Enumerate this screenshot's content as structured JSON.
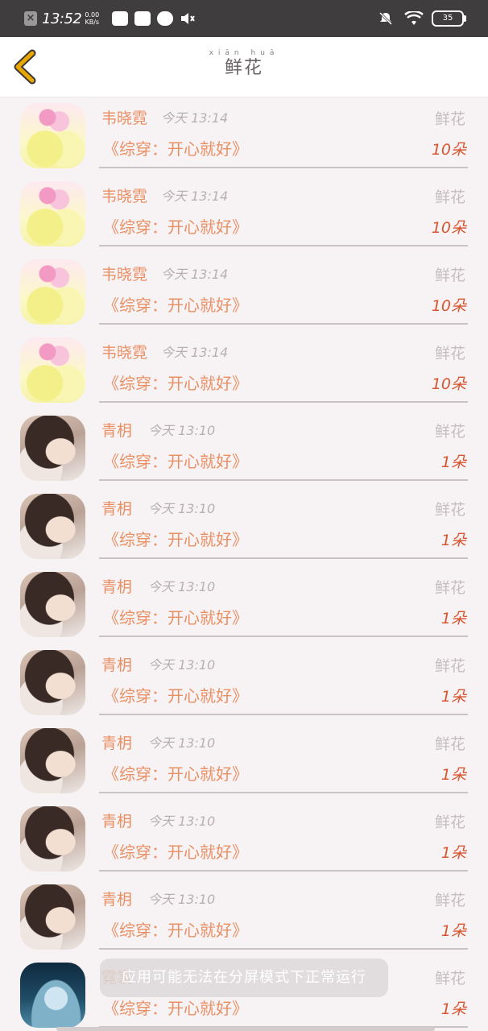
{
  "status_bar": {
    "time": "13:52",
    "speed_value": "0.00",
    "speed_unit": "KB/s",
    "battery": "35"
  },
  "header": {
    "title_pinyin": "xiān huā",
    "title": "鲜花",
    "back_icon": "chevron-left-icon",
    "accent_color": "#e8a600"
  },
  "gift_rows": [
    {
      "avatar": "flower",
      "name": "韦晓霓",
      "time": "今天 13:14",
      "gift_label": "鲜花",
      "book": "《综穿：开心就好》",
      "count": "10朵"
    },
    {
      "avatar": "flower",
      "name": "韦晓霓",
      "time": "今天 13:14",
      "gift_label": "鲜花",
      "book": "《综穿：开心就好》",
      "count": "10朵"
    },
    {
      "avatar": "flower",
      "name": "韦晓霓",
      "time": "今天 13:14",
      "gift_label": "鲜花",
      "book": "《综穿：开心就好》",
      "count": "10朵"
    },
    {
      "avatar": "flower",
      "name": "韦晓霓",
      "time": "今天 13:14",
      "gift_label": "鲜花",
      "book": "《综穿：开心就好》",
      "count": "10朵"
    },
    {
      "avatar": "girl",
      "name": "青枂",
      "time": "今天 13:10",
      "gift_label": "鲜花",
      "book": "《综穿：开心就好》",
      "count": "1朵"
    },
    {
      "avatar": "girl",
      "name": "青枂",
      "time": "今天 13:10",
      "gift_label": "鲜花",
      "book": "《综穿：开心就好》",
      "count": "1朵"
    },
    {
      "avatar": "girl",
      "name": "青枂",
      "time": "今天 13:10",
      "gift_label": "鲜花",
      "book": "《综穿：开心就好》",
      "count": "1朵"
    },
    {
      "avatar": "girl",
      "name": "青枂",
      "time": "今天 13:10",
      "gift_label": "鲜花",
      "book": "《综穿：开心就好》",
      "count": "1朵"
    },
    {
      "avatar": "girl",
      "name": "青枂",
      "time": "今天 13:10",
      "gift_label": "鲜花",
      "book": "《综穿：开心就好》",
      "count": "1朵"
    },
    {
      "avatar": "girl",
      "name": "青枂",
      "time": "今天 13:10",
      "gift_label": "鲜花",
      "book": "《综穿：开心就好》",
      "count": "1朵"
    },
    {
      "avatar": "girl",
      "name": "青枂",
      "time": "今天 13:10",
      "gift_label": "鲜花",
      "book": "《综穿：开心就好》",
      "count": "1朵"
    },
    {
      "avatar": "water",
      "name": "霓裳",
      "time": "",
      "gift_label": "鲜花",
      "book": "《综穿：开心就好》",
      "count": "1朵"
    }
  ],
  "toast": "应用可能无法在分屏模式下正常运行",
  "colors": {
    "name": "#e88f64",
    "count": "#d9552f",
    "muted": "#c5bebf"
  }
}
